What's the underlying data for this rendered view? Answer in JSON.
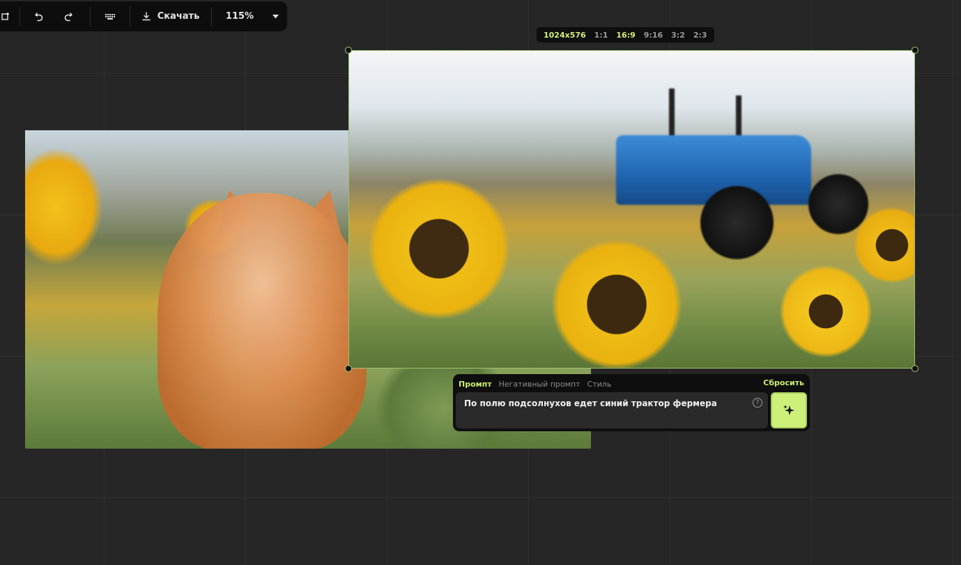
{
  "toolbar": {
    "download_label": "Скачать",
    "zoom_level": "115%",
    "icons": [
      "layers-icon",
      "undo-icon",
      "redo-icon",
      "keyboard-icon",
      "download-icon",
      "chevron-down-icon"
    ]
  },
  "ratio_bar": {
    "resolution": "1024x576",
    "options": [
      "1:1",
      "16:9",
      "9:16",
      "3:2",
      "2:3"
    ],
    "selected": "16:9"
  },
  "prompt_panel": {
    "tabs": [
      "Промпт",
      "Негативный промпт",
      "Стиль"
    ],
    "active_tab": "Промпт",
    "reset_label": "Сбросить",
    "prompt_text": "По полю подсолнухов едет синий трактор фермера",
    "help_symbol": "?",
    "generate_icon": "sparkle-icon"
  },
  "colors": {
    "background": "#262626",
    "panel": "#0e0e0e",
    "accent": "#cdf07a",
    "selection": "#9fc36d"
  }
}
